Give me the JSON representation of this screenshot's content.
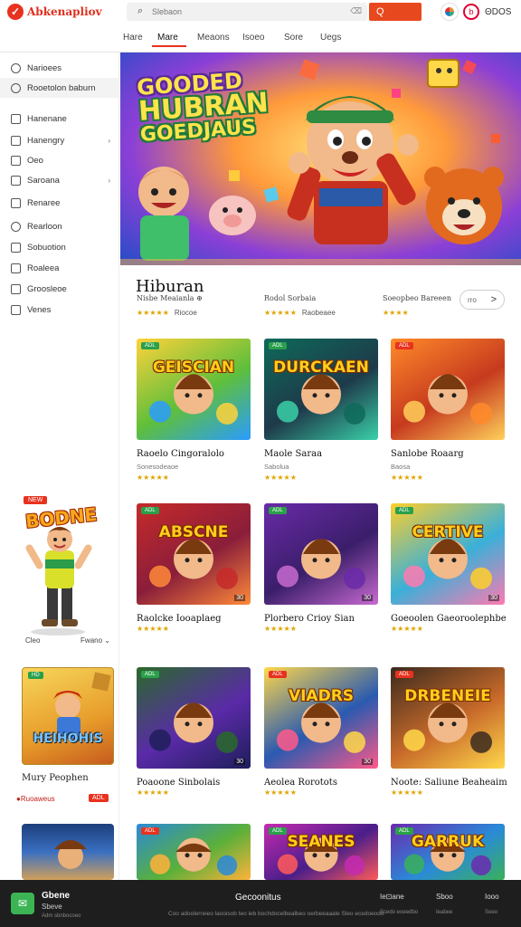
{
  "header": {
    "logo_text": "Abkenapliov",
    "search_placeholder": "Slebaon",
    "search_hint": "⌫",
    "search_button": "Q",
    "icon_b_label": "b",
    "icon_c_label": "ΘDOS"
  },
  "nav": {
    "tabs": [
      "Hare",
      "Mare",
      "Meaons",
      "Isoeo",
      "Sore",
      "Uegs"
    ],
    "active_index": 1
  },
  "sidebar": {
    "items": [
      {
        "label": "Narioees",
        "icon": "search-icon"
      },
      {
        "label": "Rooetolon baburn",
        "icon": "search-icon"
      },
      {
        "label": "Hanenane",
        "icon": "grid-icon"
      },
      {
        "label": "Hanengry",
        "icon": "folder-icon"
      },
      {
        "label": "Oeo",
        "icon": "tag-icon"
      },
      {
        "label": "Saroana",
        "icon": "gamepad-icon"
      },
      {
        "label": "Renaree",
        "icon": "box-icon"
      },
      {
        "label": "Rearloon",
        "icon": "clock-icon"
      },
      {
        "label": "Sobuotion",
        "icon": "chart-icon"
      },
      {
        "label": "Roaleea",
        "icon": "square-icon"
      },
      {
        "label": "Groosleoe",
        "icon": "play-icon"
      },
      {
        "label": "Venes",
        "icon": "list-icon"
      }
    ],
    "promo_badge": "NEW",
    "promo_title": "BODNE",
    "promo_left": "Cleo",
    "promo_right": "Fwano",
    "card_title": "Mury Peophen",
    "card_meta": "Ruoaweus",
    "card_tag": "ADL",
    "card_badge": "HD",
    "card_logo": "HEIHOHIS"
  },
  "banner": {
    "title_line1": "GOODED",
    "title_line2": "HUBRAN",
    "title_line3": "GOEDJAUS"
  },
  "section": {
    "title": "Hiburan",
    "meta": [
      {
        "text": "Nisbe Meaianla ⊕",
        "stars": "★★★★★",
        "count": "Riocoe"
      },
      {
        "text": "Rodol Sorbaia",
        "stars": "★★★★★",
        "count": "Raobeaee"
      },
      {
        "text": "Soeopbeo Bareeen",
        "stars": "★★★★",
        "count": ""
      }
    ],
    "more_label": "rro",
    "more_chevron": ">"
  },
  "cards": [
    {
      "title": "Raoelo Cingoralolo",
      "sub": "Sonesodeaoe",
      "stars": "★★★★★",
      "badge": "ADL",
      "thumb_title": "GEISCIAN",
      "duration": ""
    },
    {
      "title": "Maole Saraa",
      "sub": "Sabolua",
      "stars": "★★★★★",
      "badge": "ADL",
      "thumb_title": "DURCKAEN",
      "duration": ""
    },
    {
      "title": "Sanlobe Roaarg",
      "sub": "Baosa",
      "stars": "★★★★★",
      "badge": "ADL",
      "thumb_title": "",
      "duration": ""
    },
    {
      "title": "Raolcke Iooaplaeg",
      "sub": "",
      "stars": "★★★★★",
      "badge": "ADL",
      "thumb_title": "ABSCNE",
      "duration": "30"
    },
    {
      "title": "Plorbero Crioy Sian",
      "sub": "",
      "stars": "★★★★★",
      "badge": "ADL",
      "thumb_title": "",
      "duration": "30"
    },
    {
      "title": "Goeoolen Gaeoroolephbe",
      "sub": "",
      "stars": "★★★★★",
      "badge": "ADL",
      "thumb_title": "CERTIVE",
      "duration": "30"
    },
    {
      "title": "Poaoone Sinbolais",
      "sub": "",
      "stars": "★★★★★",
      "badge": "ADL",
      "thumb_title": "",
      "duration": "30"
    },
    {
      "title": "Aeolea Rorotots",
      "sub": "",
      "stars": "★★★★★",
      "badge": "ADL",
      "thumb_title": "VIADRS",
      "duration": "30"
    },
    {
      "title": "Noote: Saliune Beaheaim",
      "sub": "",
      "stars": "★★★★★",
      "badge": "ADL",
      "thumb_title": "DRBENEIE",
      "duration": ""
    },
    {
      "title": "",
      "sub": "",
      "stars": "",
      "badge": "ADL",
      "thumb_title": "",
      "duration": ""
    },
    {
      "title": "",
      "sub": "",
      "stars": "",
      "badge": "ADL",
      "thumb_title": "SEANES",
      "duration": ""
    },
    {
      "title": "",
      "sub": "",
      "stars": "",
      "badge": "ADL",
      "thumb_title": "GARRUK",
      "duration": ""
    }
  ],
  "footer": {
    "app_name": "Gbene",
    "app_sub": "Sbeve",
    "app_tiny": "Adm sbnbocoeo",
    "center_title": "Gecoonitus",
    "center_line": "Coo adoolerreieo laooisob teo ieb bochdocelbealbeo oerbeeaaale Sleo ecedoeodo",
    "right1": "Ie⊡ane",
    "right1_sub": "Scedo eoeedbo",
    "right2": "Sboo",
    "right2_sub": "Ieabee",
    "right3": "Iooo",
    "right3_sub": "Soeo"
  },
  "colors": {
    "accent": "#e8321f",
    "footer_bg": "#1e1e1e",
    "star": "#e0a400"
  }
}
